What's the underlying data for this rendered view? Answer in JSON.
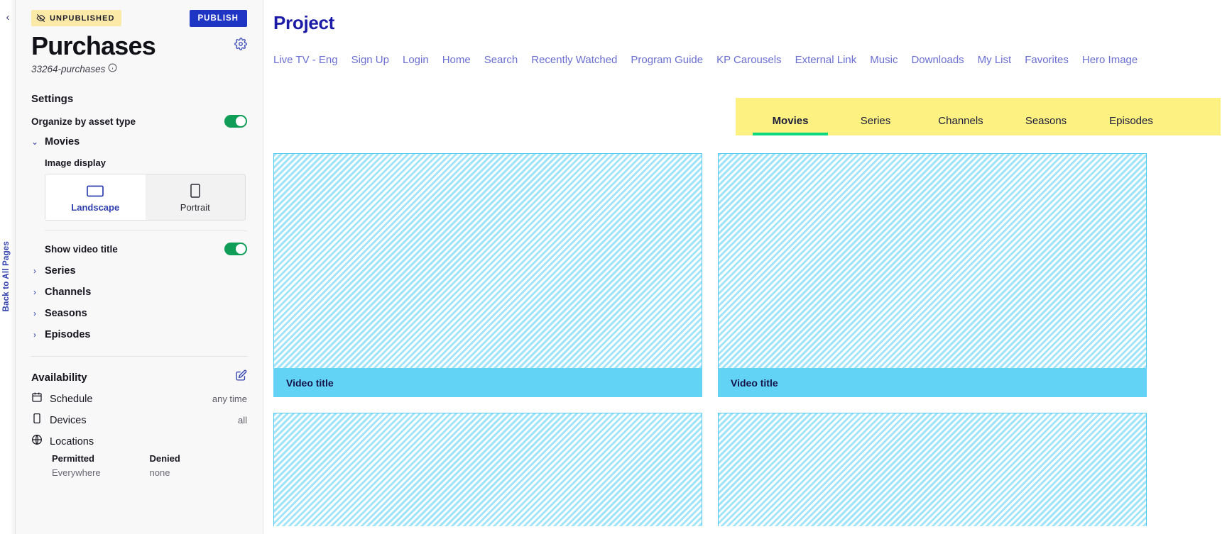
{
  "rail": {
    "collapse_icon": "chevron-left-icon",
    "back_label": "Back to All Pages"
  },
  "panel": {
    "status_badge": "UNPUBLISHED",
    "status_icon": "eye-off-icon",
    "publish_label": "PUBLISH",
    "title": "Purchases",
    "settings_icon": "gear-icon",
    "slug": "33264-purchases",
    "slug_info_icon": "info-icon",
    "settings_heading": "Settings",
    "organize_label": "Organize by asset type",
    "organize_toggle_on": true,
    "movies_group": "Movies",
    "image_display_label": "Image display",
    "segments": [
      {
        "label": "Landscape",
        "icon": "landscape-rect-icon",
        "active": true
      },
      {
        "label": "Portrait",
        "icon": "portrait-rect-icon",
        "active": false
      }
    ],
    "show_video_title_label": "Show video title",
    "show_video_title_on": true,
    "collapsed_groups": [
      "Series",
      "Channels",
      "Seasons",
      "Episodes"
    ],
    "availability_heading": "Availability",
    "availability_edit_icon": "edit-pencil-icon",
    "availability_rows": [
      {
        "icon": "calendar-icon",
        "name": "Schedule",
        "value": "any time"
      },
      {
        "icon": "device-icon",
        "name": "Devices",
        "value": "all"
      },
      {
        "icon": "globe-icon",
        "name": "Locations",
        "value": ""
      }
    ],
    "locations": {
      "permitted_header": "Permitted",
      "permitted_value": "Everywhere",
      "denied_header": "Denied",
      "denied_value": "none"
    }
  },
  "preview": {
    "project_title": "Project",
    "nav_links": [
      "Live TV - Eng",
      "Sign Up",
      "Login",
      "Home",
      "Search",
      "Recently Watched",
      "Program Guide",
      "KP Carousels",
      "External Link",
      "Music",
      "Downloads",
      "My List",
      "Favorites",
      "Hero Image"
    ],
    "tabs": [
      {
        "label": "Movies",
        "active": true
      },
      {
        "label": "Series",
        "active": false
      },
      {
        "label": "Channels",
        "active": false
      },
      {
        "label": "Seasons",
        "active": false
      },
      {
        "label": "Episodes",
        "active": false
      }
    ],
    "cards": [
      {
        "title": "Video title",
        "short": false
      },
      {
        "title": "Video title",
        "short": false
      },
      {
        "title": "",
        "short": true
      },
      {
        "title": "",
        "short": true
      }
    ]
  },
  "colors": {
    "accent_blue": "#1f35c4",
    "nav_link": "#6a6fd0",
    "project_title": "#1b1ba8",
    "tabbar_yellow": "#fdf281",
    "tab_underline_green": "#0ad97d",
    "toggle_green": "#0f9d58",
    "badge_yellow": "#fbe9a8",
    "card_stripe": "#9fe4fa",
    "card_bar": "#62d2f5"
  }
}
